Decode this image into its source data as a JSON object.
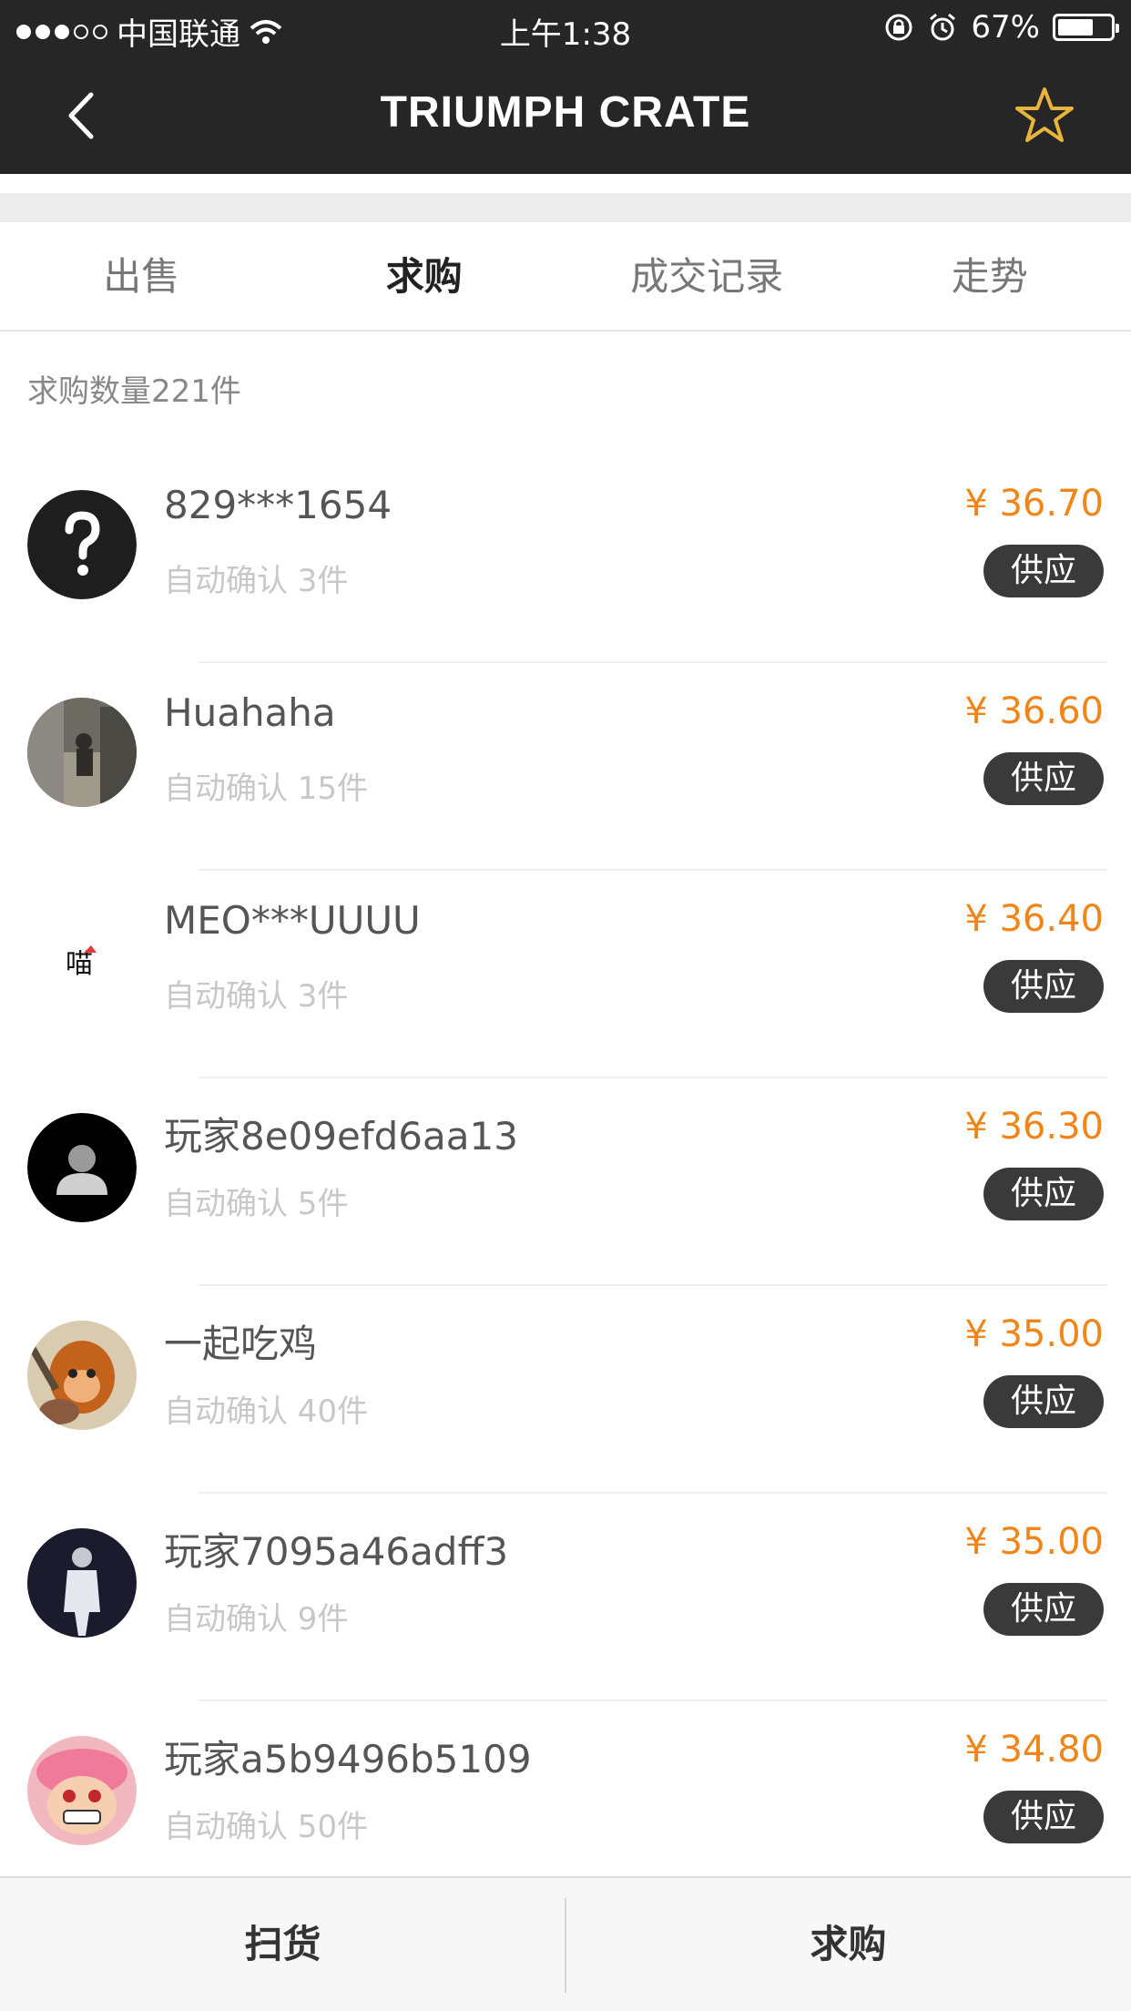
{
  "status_bar": {
    "carrier": "中国联通",
    "time": "上午1:38",
    "battery": "67%",
    "battery_level": 0.67
  },
  "nav": {
    "title": "TRIUMPH CRATE"
  },
  "tabs": [
    {
      "label": "出售",
      "active": false
    },
    {
      "label": "求购",
      "active": true
    },
    {
      "label": "成交记录",
      "active": false
    },
    {
      "label": "走势",
      "active": false
    }
  ],
  "count_label": "求购数量221件",
  "requests": [
    {
      "name": "829***1654",
      "sub": "自动确认 3件",
      "price": "¥ 36.70",
      "action": "供应"
    },
    {
      "name": "Huahaha",
      "sub": "自动确认 15件",
      "price": "¥ 36.60",
      "action": "供应"
    },
    {
      "name": "MEO***UUUU",
      "sub": "自动确认 3件",
      "price": "¥ 36.40",
      "action": "供应"
    },
    {
      "name": "玩家8e09efd6aa13",
      "sub": "自动确认 5件",
      "price": "¥ 36.30",
      "action": "供应"
    },
    {
      "name": "一起吃鸡",
      "sub": "自动确认 40件",
      "price": "¥ 35.00",
      "action": "供应"
    },
    {
      "name": "玩家7095a46adff3",
      "sub": "自动确认 9件",
      "price": "¥ 35.00",
      "action": "供应"
    },
    {
      "name": "玩家a5b9496b5109",
      "sub": "自动确认 50件",
      "price": "¥ 34.80",
      "action": "供应"
    }
  ],
  "avatar_badge_text": "喵",
  "bottom_bar": {
    "left": "扫货",
    "right": "求购"
  },
  "colors": {
    "header_bg": "#262626",
    "price": "#f08519",
    "star": "#e8b43b",
    "supply_button": "#3a3a3a"
  }
}
